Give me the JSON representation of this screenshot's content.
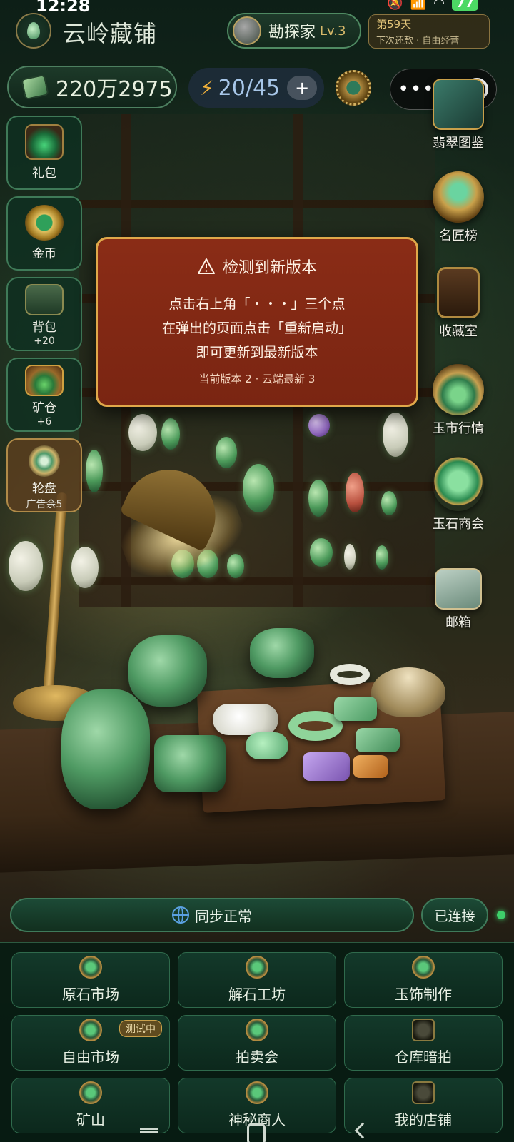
{
  "status_bar": {
    "time": "12:28",
    "signal_label": "5G",
    "battery": "77"
  },
  "header": {
    "title": "云岭藏铺",
    "rank_label": "勘探家",
    "rank_level": "Lv.3",
    "day_label": "第59天",
    "day_sub": "下次还款 · 自由经营"
  },
  "resources": {
    "gold": "220万2975",
    "energy": "20/45",
    "energy_plus": "+"
  },
  "capsule": {
    "more": "•••"
  },
  "left_panel": [
    {
      "label": "礼包",
      "sub": ""
    },
    {
      "label": "金币",
      "sub": ""
    },
    {
      "label": "背包",
      "sub": "+20"
    },
    {
      "label": "矿仓",
      "sub": "+6"
    },
    {
      "label": "轮盘",
      "sub": "广告余5"
    }
  ],
  "right_panel": [
    {
      "label": "翡翠图鉴",
      "icon": "jade-book-icon"
    },
    {
      "label": "名匠榜",
      "icon": "trophy-icon"
    },
    {
      "label": "收藏室",
      "icon": "display-cabinet-icon"
    },
    {
      "label": "玉市行情",
      "icon": "market-chart-icon"
    },
    {
      "label": "玉石商会",
      "icon": "jade-pendant-icon"
    },
    {
      "label": "邮箱",
      "icon": "mail-icon"
    }
  ],
  "dialog": {
    "title": "检测到新版本",
    "line1": "点击右上角「・・・」三个点",
    "line2": "在弹出的页面点击「重新启动」",
    "line3": "即可更新到最新版本",
    "version": "当前版本 2 · 云端最新 3"
  },
  "sync": {
    "label": "同步正常",
    "connected": "已连接",
    "status_color": "#3ecf6a"
  },
  "grid": [
    {
      "label": "原石市场",
      "badge": ""
    },
    {
      "label": "解石工坊",
      "badge": ""
    },
    {
      "label": "玉饰制作",
      "badge": ""
    },
    {
      "label": "自由市场",
      "badge": "测试中"
    },
    {
      "label": "拍卖会",
      "badge": ""
    },
    {
      "label": "仓库暗拍",
      "badge": ""
    },
    {
      "label": "矿山",
      "badge": ""
    },
    {
      "label": "神秘商人",
      "badge": ""
    },
    {
      "label": "我的店铺",
      "badge": ""
    }
  ],
  "colors": {
    "accent_gold": "#d7b96a",
    "jade_green": "#3f7a58",
    "dialog_red": "#8a2c16"
  }
}
